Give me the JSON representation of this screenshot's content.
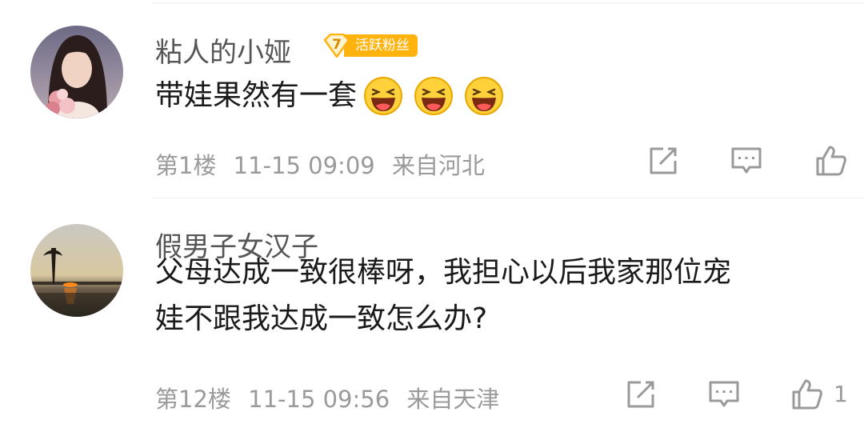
{
  "comments": [
    {
      "username": "粘人的小娅",
      "badge": {
        "level": "7",
        "label": "活跃粉丝"
      },
      "text": "带娃果然有一套",
      "emojis": [
        "laughing-emoji",
        "laughing-emoji",
        "laughing-emoji"
      ],
      "floor": "第1楼",
      "time": "11-15 09:09",
      "location": "来自河北",
      "like_count": ""
    },
    {
      "username": "假男子女汉子",
      "text_line1": "父母达成一致很棒呀，我担心以后我家那位宠",
      "text_line2": "娃不跟我达成一致怎么办?",
      "floor": "第12楼",
      "time": "11-15 09:56",
      "location": "来自天津",
      "like_count": "1"
    }
  ],
  "icons": {
    "repost": "repost-icon",
    "comment": "comment-icon",
    "like": "thumbs-up-icon"
  },
  "colors": {
    "username": "#555555",
    "text": "#1a1a1a",
    "meta": "#9a9a9a",
    "badge": "#ffb30f"
  }
}
